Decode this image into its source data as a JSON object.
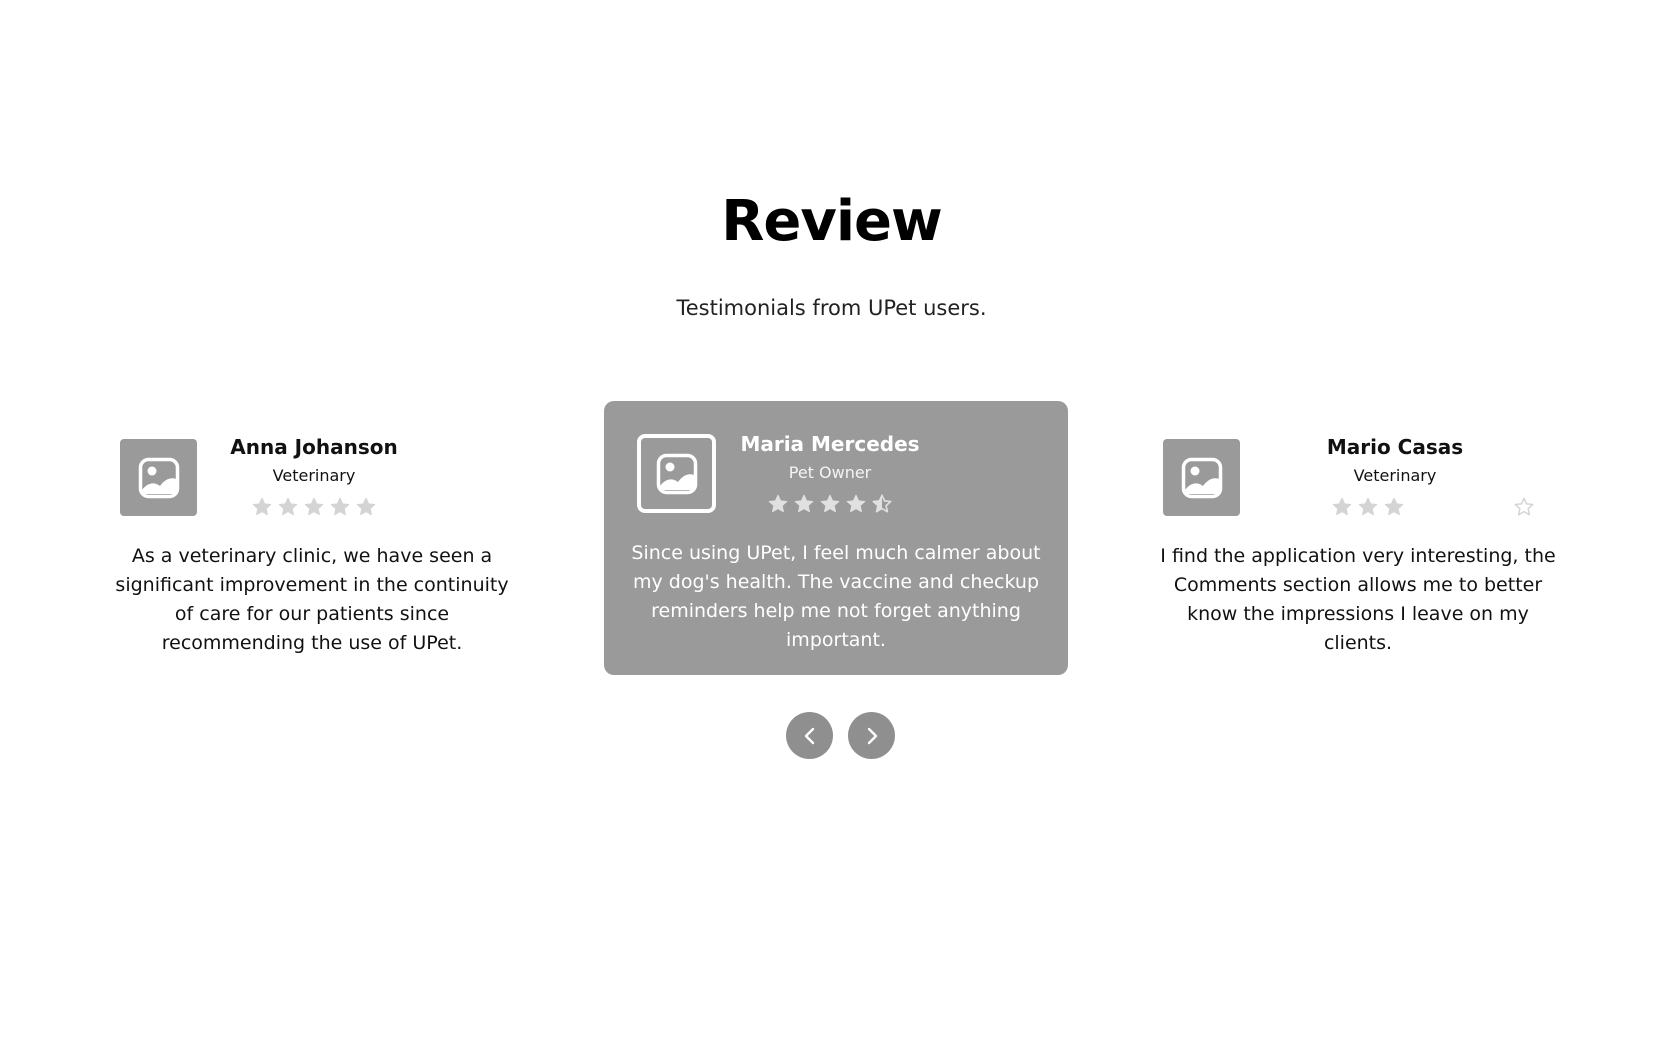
{
  "header": {
    "title": "Review",
    "subtitle": "Testimonials from UPet users."
  },
  "reviews": [
    {
      "name": "Anna Johanson",
      "role": "Veterinary",
      "rating": 5,
      "text": "As a veterinary clinic, we have seen a significant improvement in the continuity of care for our patients since recommending the use of UPet."
    },
    {
      "name": "Maria Mercedes",
      "role": "Pet Owner",
      "rating": 4.5,
      "text": "Since using UPet, I feel much calmer about my dog's health. The vaccine and checkup reminders help me not forget anything important."
    },
    {
      "name": "Mario Casas",
      "role": "Veterinary",
      "rating": 3,
      "text": "I find the application very interesting, the Comments section allows me to better know the impressions I leave on my clients."
    }
  ],
  "icons": {
    "avatar": "image-placeholder-icon",
    "star_filled": "star-icon",
    "star_half": "half-star-icon",
    "star_outline": "star-outline-icon",
    "prev": "chevron-left-icon",
    "next": "chevron-right-icon"
  },
  "colors": {
    "card_active": "#9a9a9a",
    "star_side": "#d4d4d4",
    "star_active": "#e0e0e0",
    "nav_button": "#8f8f8f"
  }
}
